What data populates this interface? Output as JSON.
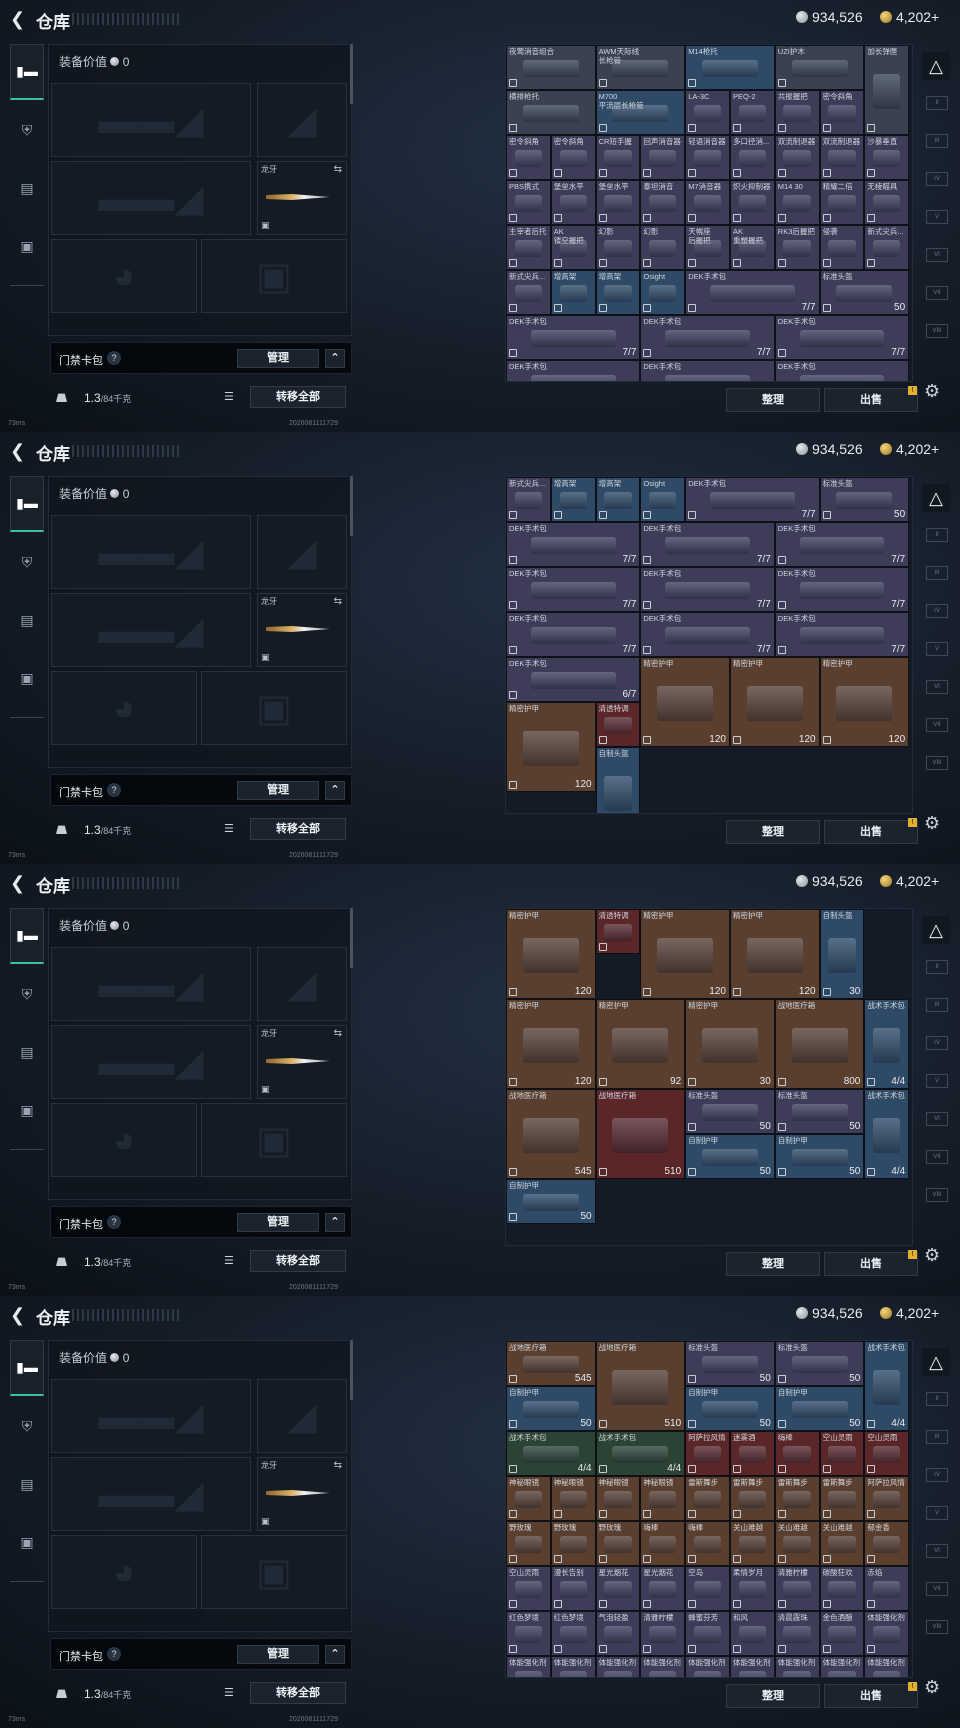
{
  "header": {
    "title": "仓库",
    "silver": "934,526",
    "gold": "4,202+"
  },
  "equip": {
    "value_label": "装备价值",
    "value": "0",
    "knife_label": "龙牙",
    "key_label": "门禁卡包",
    "help": "?",
    "manage": "管理",
    "weight_used": "1.3",
    "weight_max": "/84千克",
    "transfer_all": "转移全部"
  },
  "buttons": {
    "sort": "整理",
    "sell": "出售"
  },
  "status": {
    "uid": "2026081111729",
    "ping": "73ms"
  },
  "panels": [
    {
      "offset_rows": 0,
      "cells": [
        {
          "n": "夜莺消音组合",
          "c": "gray",
          "w": 2,
          "h": 1
        },
        {
          "n": "AWM天际线\n长枪管",
          "c": "gray",
          "w": 2,
          "h": 1
        },
        {
          "n": "M14枪托",
          "c": "blue",
          "w": 2,
          "h": 1
        },
        {
          "n": "UZI护木",
          "c": "gray",
          "w": 2,
          "h": 1
        },
        {
          "n": "加长弹匣",
          "c": "gray",
          "w": 1,
          "h": 2
        },
        {
          "n": "横排枪托",
          "c": "gray",
          "w": 2,
          "h": 1
        },
        {
          "n": "M700\n平流层长枪管",
          "c": "blue",
          "w": 2,
          "h": 1
        },
        {
          "n": "LA-3C",
          "c": "purple",
          "w": 1,
          "h": 1
        },
        {
          "n": "PEQ-2",
          "c": "purple",
          "w": 1,
          "h": 1
        },
        {
          "n": "共振握把",
          "c": "purple",
          "w": 1,
          "h": 1
        },
        {
          "n": "密令斜角",
          "c": "purple",
          "w": 1,
          "h": 1
        },
        {
          "n": "密令斜角",
          "c": "purple",
          "w": 1,
          "h": 1
        },
        {
          "n": "密令斜角",
          "c": "purple",
          "w": 1,
          "h": 1
        },
        {
          "n": "CR短手握",
          "c": "purple",
          "w": 1,
          "h": 1
        },
        {
          "n": "回声消音器",
          "c": "purple",
          "w": 1,
          "h": 1
        },
        {
          "n": "轻语消音器",
          "c": "purple",
          "w": 1,
          "h": 1
        },
        {
          "n": "多口径消...",
          "c": "purple",
          "w": 1,
          "h": 1
        },
        {
          "n": "双流制退器",
          "c": "purple",
          "w": 1,
          "h": 1
        },
        {
          "n": "双流制退器",
          "c": "purple",
          "w": 1,
          "h": 1
        },
        {
          "n": "沙暴垂直",
          "c": "purple",
          "w": 1,
          "h": 1
        },
        {
          "n": "PBS携式",
          "c": "purple",
          "w": 1,
          "h": 1
        },
        {
          "n": "堡垒水平",
          "c": "purple",
          "w": 1,
          "h": 1
        },
        {
          "n": "堡垒水平",
          "c": "purple",
          "w": 1,
          "h": 1
        },
        {
          "n": "泰坦消音",
          "c": "purple",
          "w": 1,
          "h": 1
        },
        {
          "n": "M7消音器",
          "c": "purple",
          "w": 1,
          "h": 1
        },
        {
          "n": "炽火抑制器",
          "c": "purple",
          "w": 1,
          "h": 1
        },
        {
          "n": "M14 30",
          "c": "purple",
          "w": 1,
          "h": 1
        },
        {
          "n": "精耀二倍",
          "c": "purple",
          "w": 1,
          "h": 1
        },
        {
          "n": "无棱瞄具",
          "c": "purple",
          "w": 1,
          "h": 1
        },
        {
          "n": "主宰者后托",
          "c": "purple",
          "w": 1,
          "h": 1
        },
        {
          "n": "AK\n镂空握把",
          "c": "purple",
          "w": 1,
          "h": 1
        },
        {
          "n": "幻影",
          "c": "purple",
          "w": 1,
          "h": 1
        },
        {
          "n": "幻影",
          "c": "purple",
          "w": 1,
          "h": 1
        },
        {
          "n": "天幌座\n后握把",
          "c": "purple",
          "w": 1,
          "h": 1
        },
        {
          "n": "AK\n重塑握把",
          "c": "purple",
          "w": 1,
          "h": 1
        },
        {
          "n": "RK3后握把",
          "c": "purple",
          "w": 1,
          "h": 1
        },
        {
          "n": "侵袭",
          "c": "purple",
          "w": 1,
          "h": 1
        },
        {
          "n": "新式尖兵...",
          "c": "purple",
          "w": 1,
          "h": 1
        },
        {
          "n": "新式尖兵...",
          "c": "purple",
          "w": 1,
          "h": 1
        },
        {
          "n": "增高架",
          "c": "blue",
          "w": 1,
          "h": 1
        },
        {
          "n": "增高架",
          "c": "blue",
          "w": 1,
          "h": 1
        },
        {
          "n": "Osight",
          "c": "blue",
          "w": 1,
          "h": 1
        },
        {
          "n": "DEK手术包",
          "c": "purple",
          "w": 3,
          "h": 1,
          "cnt": "7/7"
        },
        {
          "n": "标准头盔",
          "c": "purple",
          "w": 2,
          "h": 1,
          "cnt": "50"
        },
        {
          "n": "DEK手术包",
          "c": "purple",
          "w": 3,
          "h": 1,
          "cnt": "7/7"
        },
        {
          "n": "DEK手术包",
          "c": "purple",
          "w": 3,
          "h": 1,
          "cnt": "7/7"
        },
        {
          "n": "DEK手术包",
          "c": "purple",
          "w": 3,
          "h": 1,
          "cnt": "7/7"
        },
        {
          "n": "DEK手术包",
          "c": "purple",
          "w": 3,
          "h": 1,
          "cnt": ""
        },
        {
          "n": "DEK手术包",
          "c": "purple",
          "w": 3,
          "h": 1,
          "cnt": ""
        },
        {
          "n": "DEK手术包",
          "c": "purple",
          "w": 3,
          "h": 1,
          "cnt": ""
        }
      ]
    },
    {
      "offset_rows": 0,
      "cells": [
        {
          "n": "新式尖兵...",
          "c": "purple",
          "w": 1,
          "h": 1
        },
        {
          "n": "增高架",
          "c": "blue",
          "w": 1,
          "h": 1
        },
        {
          "n": "增高架",
          "c": "blue",
          "w": 1,
          "h": 1
        },
        {
          "n": "Osight",
          "c": "blue",
          "w": 1,
          "h": 1
        },
        {
          "n": "DEK手术包",
          "c": "purple",
          "w": 3,
          "h": 1,
          "cnt": "7/7"
        },
        {
          "n": "标准头盔",
          "c": "purple",
          "w": 2,
          "h": 1,
          "cnt": "50"
        },
        {
          "n": "DEK手术包",
          "c": "purple",
          "w": 3,
          "h": 1,
          "cnt": "7/7"
        },
        {
          "n": "DEK手术包",
          "c": "purple",
          "w": 3,
          "h": 1,
          "cnt": "7/7"
        },
        {
          "n": "DEK手术包",
          "c": "purple",
          "w": 3,
          "h": 1,
          "cnt": "7/7"
        },
        {
          "n": "DEK手术包",
          "c": "purple",
          "w": 3,
          "h": 1,
          "cnt": "7/7"
        },
        {
          "n": "DEK手术包",
          "c": "purple",
          "w": 3,
          "h": 1,
          "cnt": "7/7"
        },
        {
          "n": "DEK手术包",
          "c": "purple",
          "w": 3,
          "h": 1,
          "cnt": "7/7"
        },
        {
          "n": "DEK手术包",
          "c": "purple",
          "w": 3,
          "h": 1,
          "cnt": "7/7"
        },
        {
          "n": "DEK手术包",
          "c": "purple",
          "w": 3,
          "h": 1,
          "cnt": "7/7"
        },
        {
          "n": "DEK手术包",
          "c": "purple",
          "w": 3,
          "h": 1,
          "cnt": "7/7"
        },
        {
          "n": "DEK手术包",
          "c": "purple",
          "w": 3,
          "h": 1,
          "cnt": "6/7"
        },
        {
          "n": "精密护甲",
          "c": "brown",
          "w": 2,
          "h": 2,
          "cnt": "120"
        },
        {
          "n": "精密护甲",
          "c": "brown",
          "w": 2,
          "h": 2,
          "cnt": "120"
        },
        {
          "n": "精密护甲",
          "c": "brown",
          "w": 2,
          "h": 2,
          "cnt": "120"
        },
        {
          "n": "精密护甲",
          "c": "brown",
          "w": 2,
          "h": 2,
          "cnt": "120"
        },
        {
          "n": "清透特调",
          "c": "red",
          "w": 1,
          "h": 1
        },
        {
          "n": "自制头盔",
          "c": "blue",
          "w": 1,
          "h": 2
        }
      ]
    },
    {
      "offset_rows": 0,
      "cells": [
        {
          "n": "精密护甲",
          "c": "brown",
          "w": 2,
          "h": 2,
          "cnt": "120"
        },
        {
          "n": "清透特调",
          "c": "red",
          "w": 1,
          "h": 1
        },
        {
          "n": "精密护甲",
          "c": "brown",
          "w": 2,
          "h": 2,
          "cnt": "120"
        },
        {
          "n": "精密护甲",
          "c": "brown",
          "w": 2,
          "h": 2,
          "cnt": "120"
        },
        {
          "n": "自制头盔",
          "c": "blue",
          "w": 1,
          "h": 2,
          "cnt": "30"
        },
        {
          "n": "精密护甲",
          "c": "brown",
          "w": 2,
          "h": 2,
          "cnt": "120"
        },
        {
          "n": "精密护甲",
          "c": "brown",
          "w": 2,
          "h": 2,
          "cnt": "92"
        },
        {
          "n": "精密护甲",
          "c": "brown",
          "w": 2,
          "h": 2,
          "cnt": "30"
        },
        {
          "n": "战地医疗箱",
          "c": "brown",
          "w": 2,
          "h": 2,
          "cnt": "800"
        },
        {
          "n": "战术手术包",
          "c": "blue",
          "w": 1,
          "h": 2,
          "cnt": "4/4"
        },
        {
          "n": "战地医疗箱",
          "c": "brown",
          "w": 2,
          "h": 2,
          "cnt": "545"
        },
        {
          "n": "战地医疗箱",
          "c": "red",
          "w": 2,
          "h": 2,
          "cnt": "510"
        },
        {
          "n": "标准头盔",
          "c": "purple",
          "w": 2,
          "h": 1,
          "cnt": "50"
        },
        {
          "n": "标准头盔",
          "c": "purple",
          "w": 2,
          "h": 1,
          "cnt": "50"
        },
        {
          "n": "战术手术包",
          "c": "blue",
          "w": 1,
          "h": 2,
          "cnt": "4/4"
        },
        {
          "n": "自制护甲",
          "c": "blue",
          "w": 2,
          "h": 1,
          "cnt": "50"
        },
        {
          "n": "自制护甲",
          "c": "blue",
          "w": 2,
          "h": 1,
          "cnt": "50"
        },
        {
          "n": "自制护甲",
          "c": "blue",
          "w": 2,
          "h": 1,
          "cnt": "50"
        }
      ]
    },
    {
      "offset_rows": 0,
      "cells": [
        {
          "n": "战地医疗箱",
          "c": "brown",
          "w": 2,
          "h": 1,
          "cnt": "545"
        },
        {
          "n": "战地医疗箱",
          "c": "brown",
          "w": 2,
          "h": 2,
          "cnt": "510"
        },
        {
          "n": "标准头盔",
          "c": "purple",
          "w": 2,
          "h": 1,
          "cnt": "50"
        },
        {
          "n": "标准头盔",
          "c": "purple",
          "w": 2,
          "h": 1,
          "cnt": "50"
        },
        {
          "n": "战术手术包",
          "c": "blue",
          "w": 1,
          "h": 2,
          "cnt": "4/4"
        },
        {
          "n": "自制护甲",
          "c": "blue",
          "w": 2,
          "h": 1,
          "cnt": "50"
        },
        {
          "n": "自制护甲",
          "c": "blue",
          "w": 2,
          "h": 1,
          "cnt": "50"
        },
        {
          "n": "自制护甲",
          "c": "blue",
          "w": 2,
          "h": 1,
          "cnt": "50"
        },
        {
          "n": "战术手术包",
          "c": "green",
          "w": 2,
          "h": 1,
          "cnt": "4/4"
        },
        {
          "n": "战术手术包",
          "c": "green",
          "w": 2,
          "h": 1,
          "cnt": "4/4"
        },
        {
          "n": "阿萨拉风情",
          "c": "red",
          "w": 1,
          "h": 1
        },
        {
          "n": "迷雾酒",
          "c": "red",
          "w": 1,
          "h": 1
        },
        {
          "n": "嗨棒",
          "c": "red",
          "w": 1,
          "h": 1
        },
        {
          "n": "空山灵雨",
          "c": "red",
          "w": 1,
          "h": 1
        },
        {
          "n": "空山灵雨",
          "c": "red",
          "w": 1,
          "h": 1
        },
        {
          "n": "神秘眼镜",
          "c": "brown",
          "w": 1,
          "h": 1
        },
        {
          "n": "神秘眼镜",
          "c": "brown",
          "w": 1,
          "h": 1
        },
        {
          "n": "神秘眼镜",
          "c": "brown",
          "w": 1,
          "h": 1
        },
        {
          "n": "神秘眼镜",
          "c": "brown",
          "w": 1,
          "h": 1
        },
        {
          "n": "雷斯舞步",
          "c": "brown",
          "w": 1,
          "h": 1
        },
        {
          "n": "雷斯舞步",
          "c": "brown",
          "w": 1,
          "h": 1
        },
        {
          "n": "雷斯舞步",
          "c": "brown",
          "w": 1,
          "h": 1
        },
        {
          "n": "雷斯舞步",
          "c": "brown",
          "w": 1,
          "h": 1
        },
        {
          "n": "阿萨拉风情",
          "c": "brown",
          "w": 1,
          "h": 1
        },
        {
          "n": "野玫瑰",
          "c": "brown",
          "w": 1,
          "h": 1
        },
        {
          "n": "野玫瑰",
          "c": "brown",
          "w": 1,
          "h": 1
        },
        {
          "n": "野玫瑰",
          "c": "brown",
          "w": 1,
          "h": 1
        },
        {
          "n": "嗨棒",
          "c": "brown",
          "w": 1,
          "h": 1
        },
        {
          "n": "嗨棒",
          "c": "brown",
          "w": 1,
          "h": 1
        },
        {
          "n": "关山难越",
          "c": "brown",
          "w": 1,
          "h": 1
        },
        {
          "n": "关山难越",
          "c": "brown",
          "w": 1,
          "h": 1
        },
        {
          "n": "关山难越",
          "c": "brown",
          "w": 1,
          "h": 1
        },
        {
          "n": "郁金香",
          "c": "brown",
          "w": 1,
          "h": 1
        },
        {
          "n": "空山灵雨",
          "c": "purple",
          "w": 1,
          "h": 1
        },
        {
          "n": "漫长告别",
          "c": "purple",
          "w": 1,
          "h": 1
        },
        {
          "n": "星光烟花",
          "c": "purple",
          "w": 1,
          "h": 1
        },
        {
          "n": "星光烟花",
          "c": "purple",
          "w": 1,
          "h": 1
        },
        {
          "n": "空岛",
          "c": "purple",
          "w": 1,
          "h": 1
        },
        {
          "n": "柔情岁月",
          "c": "purple",
          "w": 1,
          "h": 1
        },
        {
          "n": "清雅柠檬",
          "c": "purple",
          "w": 1,
          "h": 1
        },
        {
          "n": "碳酸狂欢",
          "c": "purple",
          "w": 1,
          "h": 1
        },
        {
          "n": "赤焰",
          "c": "purple",
          "w": 1,
          "h": 1
        },
        {
          "n": "红色梦境",
          "c": "purple",
          "w": 1,
          "h": 1
        },
        {
          "n": "红色梦境",
          "c": "purple",
          "w": 1,
          "h": 1
        },
        {
          "n": "气泡轻盈",
          "c": "purple",
          "w": 1,
          "h": 1
        },
        {
          "n": "清雅柠檬",
          "c": "purple",
          "w": 1,
          "h": 1
        },
        {
          "n": "蜂蜜芬芳",
          "c": "purple",
          "w": 1,
          "h": 1
        },
        {
          "n": "和风",
          "c": "purple",
          "w": 1,
          "h": 1
        },
        {
          "n": "清晨霞珠",
          "c": "purple",
          "w": 1,
          "h": 1
        },
        {
          "n": "金色酒酿",
          "c": "purple",
          "w": 1,
          "h": 1
        },
        {
          "n": "体能强化剂",
          "c": "purple",
          "w": 1,
          "h": 1
        },
        {
          "n": "体能强化剂",
          "c": "purple",
          "w": 1,
          "h": 1
        },
        {
          "n": "体能强化剂",
          "c": "purple",
          "w": 1,
          "h": 1
        },
        {
          "n": "体能强化剂",
          "c": "purple",
          "w": 1,
          "h": 1
        },
        {
          "n": "体能强化剂",
          "c": "purple",
          "w": 1,
          "h": 1
        },
        {
          "n": "体能强化剂",
          "c": "purple",
          "w": 1,
          "h": 1
        },
        {
          "n": "体能强化剂",
          "c": "purple",
          "w": 1,
          "h": 1
        },
        {
          "n": "体能强化剂",
          "c": "purple",
          "w": 1,
          "h": 1
        },
        {
          "n": "体能强化剂",
          "c": "purple",
          "w": 1,
          "h": 1
        },
        {
          "n": "体能强化剂",
          "c": "purple",
          "w": 1,
          "h": 1
        }
      ]
    }
  ],
  "colors": {
    "accent": "#3cc0a0",
    "gold": "#e0b030"
  },
  "icons": {
    "back": "chevron-left-icon",
    "gear": "gear-icon",
    "helmet": "helmet-icon",
    "lock": "lock-icon"
  }
}
